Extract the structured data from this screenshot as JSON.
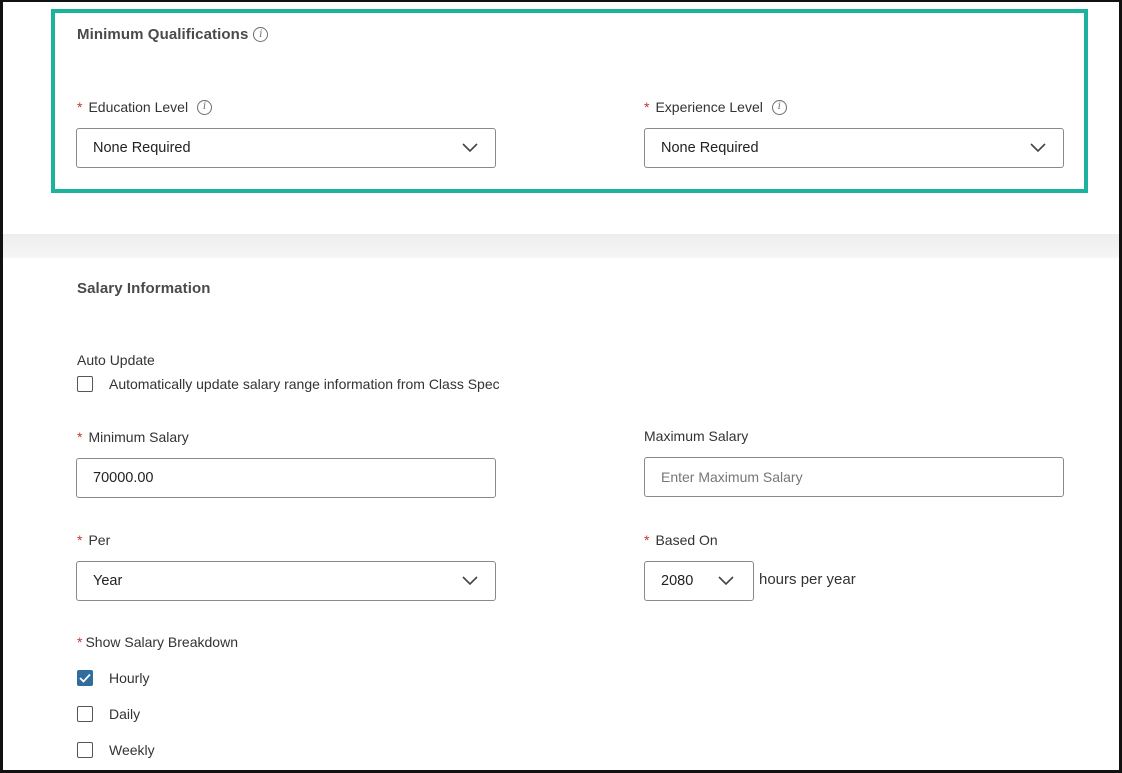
{
  "min_qual": {
    "title": "Minimum Qualifications",
    "education": {
      "label": "Education Level",
      "value": "None Required"
    },
    "experience": {
      "label": "Experience Level",
      "value": "None Required"
    }
  },
  "salary": {
    "title": "Salary Information",
    "auto_update": {
      "label": "Auto Update",
      "checkbox_label": "Automatically update salary range information from Class Spec",
      "checked": false
    },
    "minimum": {
      "label": "Minimum Salary",
      "value": "70000.00"
    },
    "maximum": {
      "label": "Maximum Salary",
      "placeholder": "Enter Maximum Salary"
    },
    "per": {
      "label": "Per",
      "value": "Year"
    },
    "based_on": {
      "label": "Based On",
      "value": "2080",
      "suffix": "hours per year"
    },
    "breakdown": {
      "label": "Show Salary Breakdown",
      "options": [
        {
          "label": "Hourly",
          "checked": true
        },
        {
          "label": "Daily",
          "checked": false
        },
        {
          "label": "Weekly",
          "checked": false
        }
      ]
    }
  },
  "colors": {
    "highlight": "#1bb39e",
    "required": "#c4372a",
    "checkbox_checked": "#2e6d9e"
  },
  "icons": {
    "info": "info-icon",
    "dropdown": "chevron-down-icon",
    "check": "checkmark-icon"
  }
}
